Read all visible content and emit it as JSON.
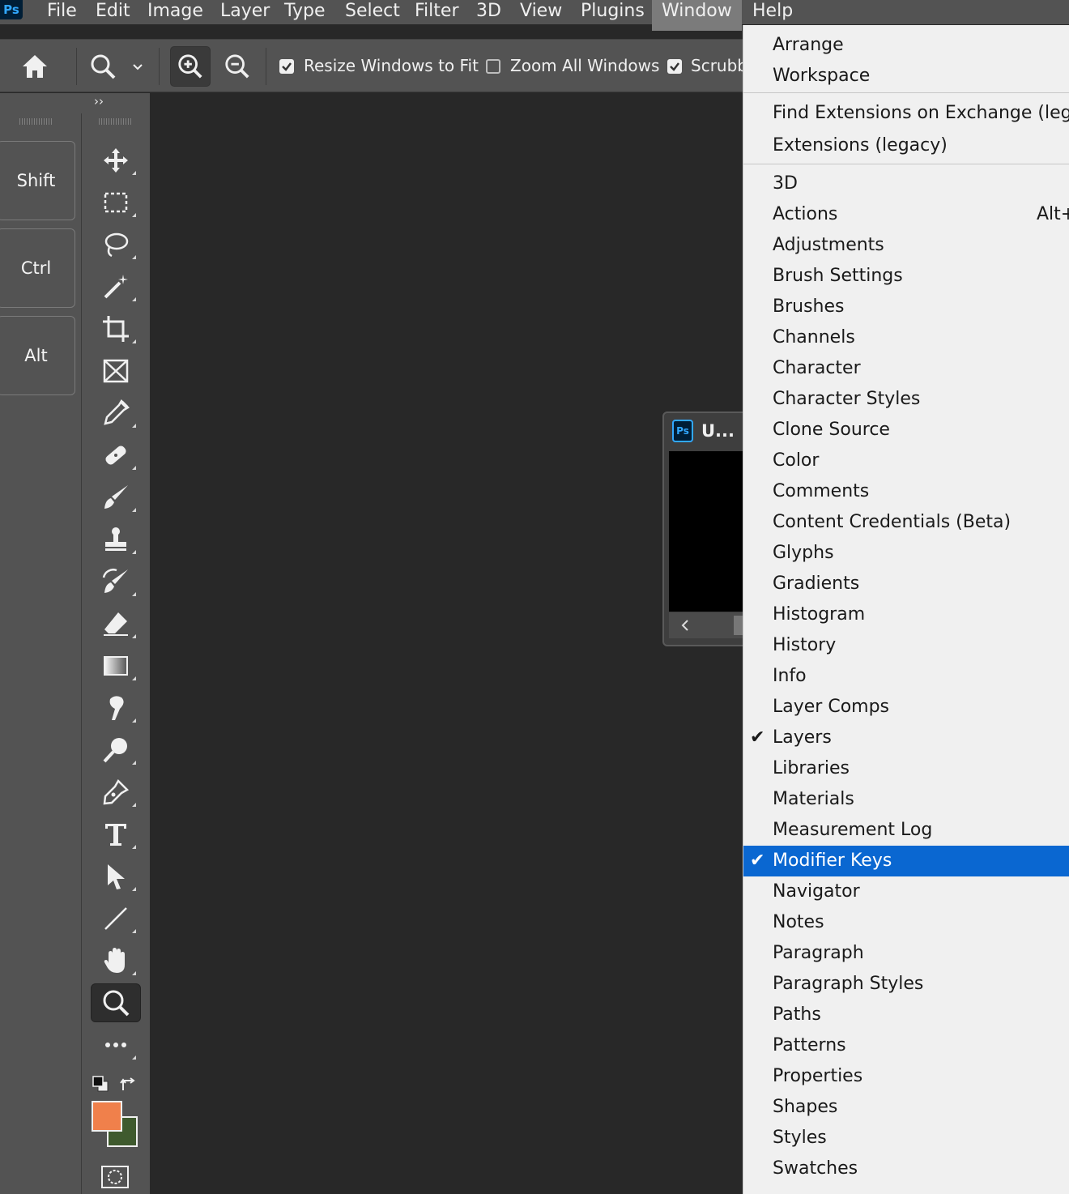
{
  "menubar": {
    "logo": "Ps",
    "items": [
      "File",
      "Edit",
      "Image",
      "Layer",
      "Type",
      "Select",
      "Filter",
      "3D",
      "View",
      "Plugins",
      "Window",
      "Help"
    ],
    "active": "Window"
  },
  "options_bar": {
    "icons": [
      "home-icon",
      "zoom-tool-icon",
      "chevron-down-icon",
      "zoom-in-icon",
      "zoom-out-icon"
    ],
    "checkboxes": [
      {
        "label": "Resize Windows to Fit",
        "checked": true
      },
      {
        "label": "Zoom All Windows",
        "checked": false
      },
      {
        "label": "Scrubby",
        "checked": true
      }
    ]
  },
  "panel_collapse": "››",
  "modifier_keys": [
    "Shift",
    "Ctrl",
    "Alt"
  ],
  "tools": [
    "move",
    "marquee",
    "lasso",
    "magic-wand",
    "crop",
    "frame",
    "eyedropper",
    "healing",
    "brush",
    "stamp",
    "history-brush",
    "eraser",
    "gradient",
    "smudge",
    "dodge",
    "pen",
    "type",
    "path-select",
    "line",
    "hand",
    "zoom",
    "more"
  ],
  "active_tool": "zoom",
  "colors": {
    "foreground": "#f0804b",
    "background": "#3f5a2e",
    "highlight": "#0a67d1"
  },
  "document": {
    "title": "U...",
    "logo": "Ps"
  },
  "window_menu": {
    "group1": [
      "Arrange",
      "Workspace"
    ],
    "group2": [
      "Find Extensions on Exchange (lega",
      "Extensions (legacy)"
    ],
    "items": [
      {
        "label": "3D"
      },
      {
        "label": "Actions",
        "shortcut": "Alt+"
      },
      {
        "label": "Adjustments"
      },
      {
        "label": "Brush Settings"
      },
      {
        "label": "Brushes"
      },
      {
        "label": "Channels"
      },
      {
        "label": "Character"
      },
      {
        "label": "Character Styles"
      },
      {
        "label": "Clone Source"
      },
      {
        "label": "Color"
      },
      {
        "label": "Comments"
      },
      {
        "label": "Content Credentials (Beta)"
      },
      {
        "label": "Glyphs"
      },
      {
        "label": "Gradients"
      },
      {
        "label": "Histogram"
      },
      {
        "label": "History"
      },
      {
        "label": "Info"
      },
      {
        "label": "Layer Comps"
      },
      {
        "label": "Layers",
        "checked": true
      },
      {
        "label": "Libraries"
      },
      {
        "label": "Materials"
      },
      {
        "label": "Measurement Log"
      },
      {
        "label": "Modifier Keys",
        "checked": true,
        "highlighted": true
      },
      {
        "label": "Navigator"
      },
      {
        "label": "Notes"
      },
      {
        "label": "Paragraph"
      },
      {
        "label": "Paragraph Styles"
      },
      {
        "label": "Paths"
      },
      {
        "label": "Patterns"
      },
      {
        "label": "Properties"
      },
      {
        "label": "Shapes"
      },
      {
        "label": "Styles"
      },
      {
        "label": "Swatches"
      }
    ]
  },
  "check_glyph": "✔"
}
